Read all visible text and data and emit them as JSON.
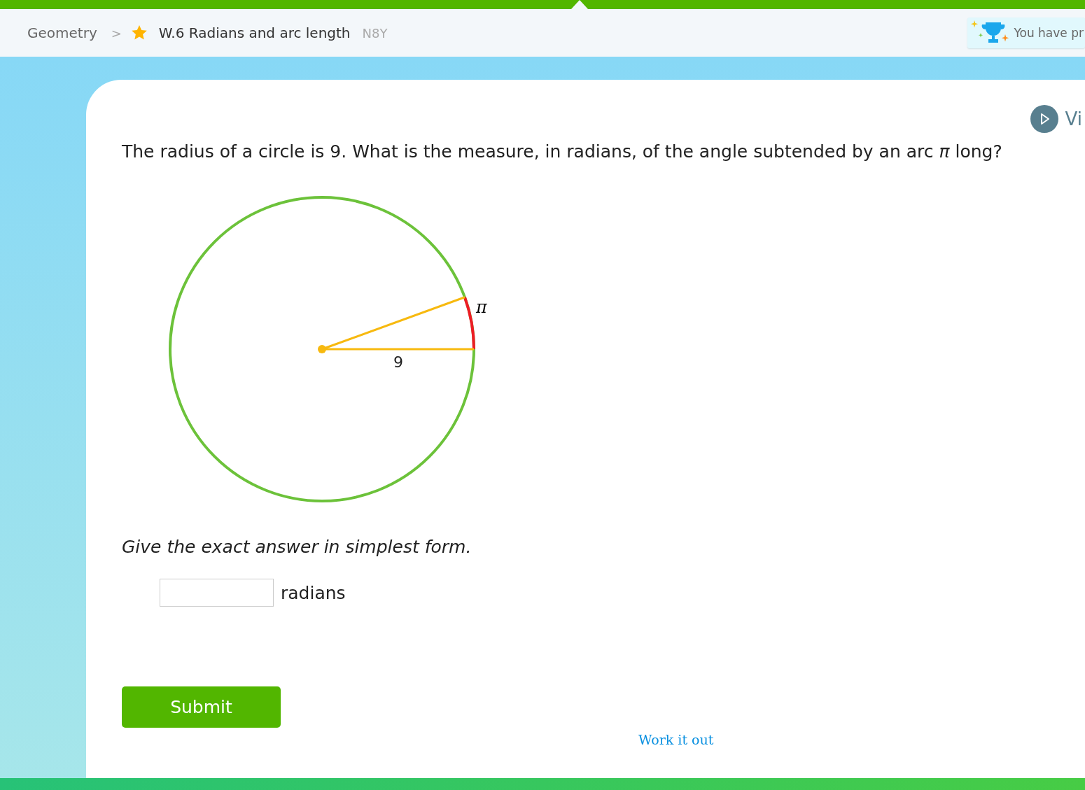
{
  "breadcrumb": {
    "subject": "Geometry",
    "separator": ">",
    "skill": "W.6 Radians and arc length",
    "code": "N8Y"
  },
  "award_banner": {
    "text": "You have pr"
  },
  "video_link": {
    "label": "Vi"
  },
  "question": {
    "text": "The radius of a circle is 9. What is the measure, in radians, of the angle subtended by an arc *π* long?",
    "figure": {
      "arc_label": "π",
      "radius_label": "9"
    },
    "instruction": "Give the exact answer in simplest form.",
    "answer": {
      "unit": "radians"
    }
  },
  "submit": {
    "label": "Submit"
  },
  "work_it_out": {
    "label": "Work it out"
  }
}
